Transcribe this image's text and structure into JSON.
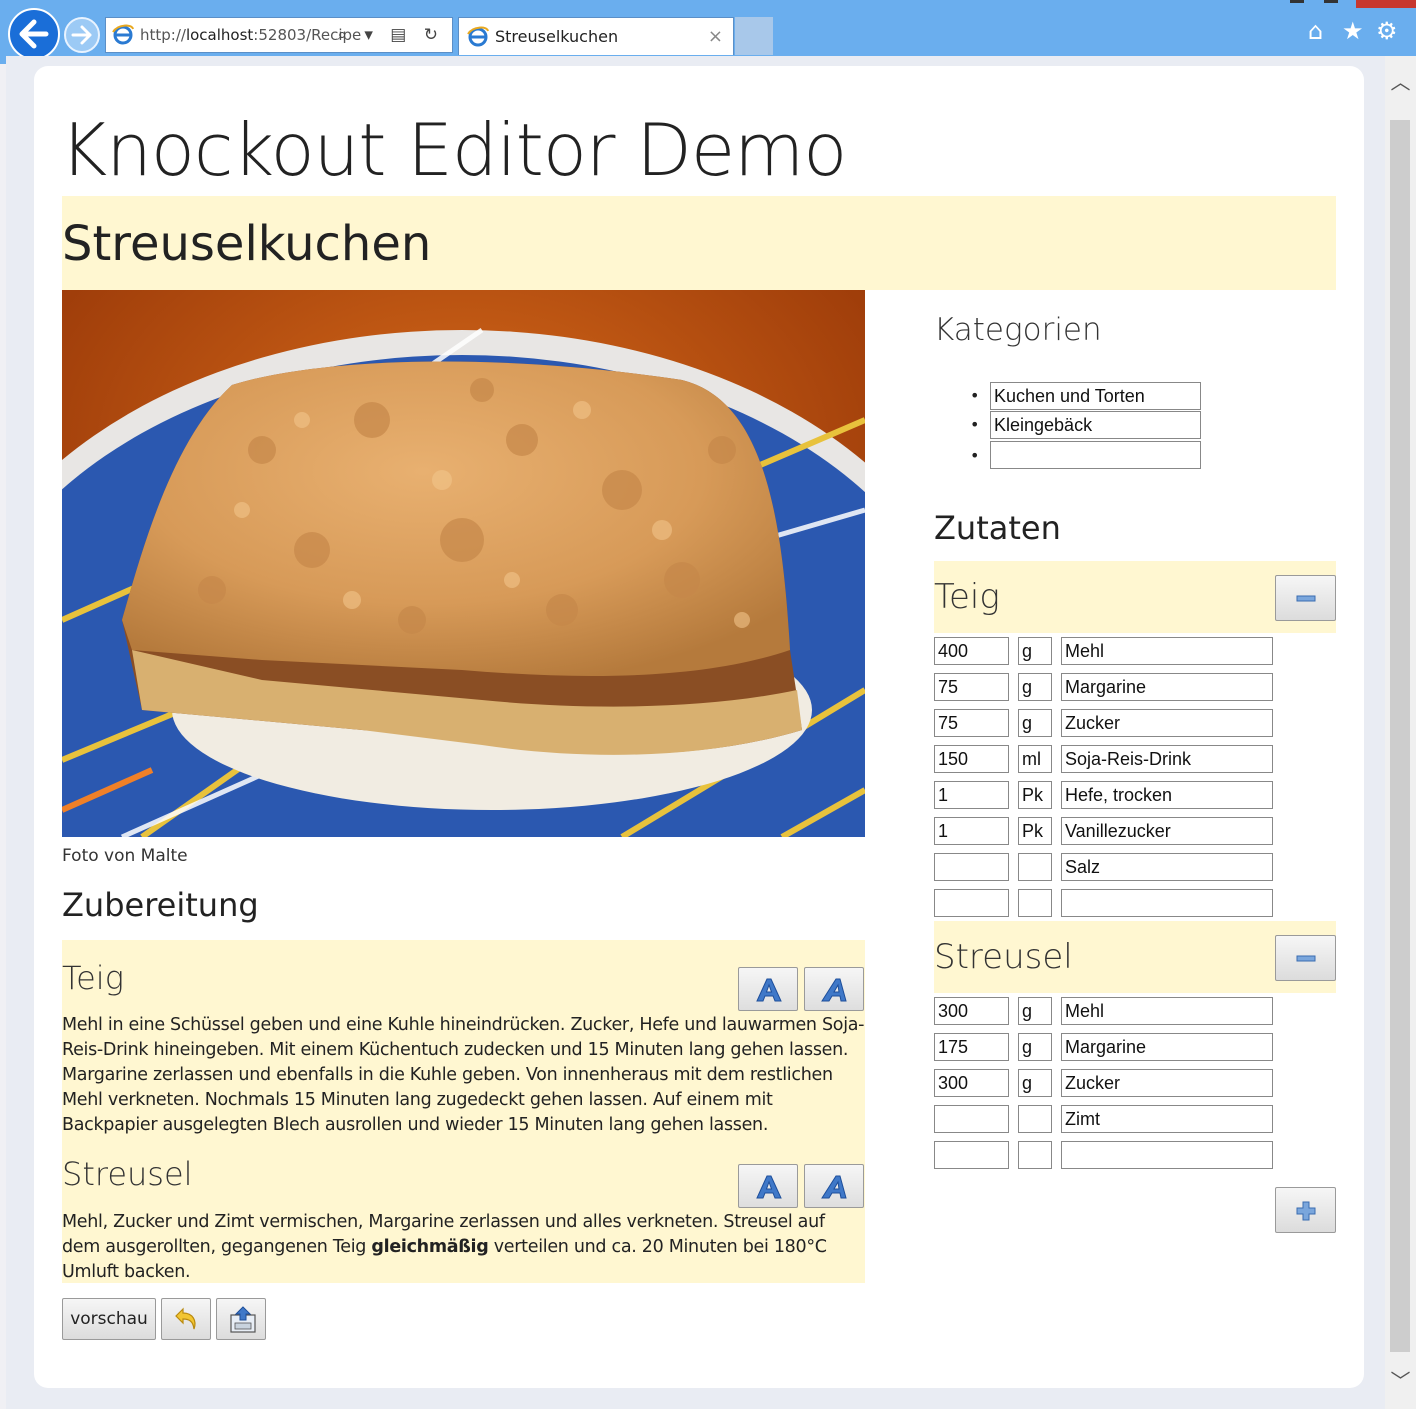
{
  "browser": {
    "url_prefix": "http://",
    "url_host": "localhost",
    "url_rest": ":52803/Recipe",
    "address_tools": "⌕ ▾ ▤ ↻",
    "tab_title": "Streuselkuchen",
    "tab_close": "×"
  },
  "page": {
    "title": "Knockout Editor Demo",
    "recipe_name": "Streuselkuchen",
    "photo_caption": "Foto von Malte",
    "section_preparation": "Zubereitung",
    "section_categories": "Kategorien",
    "section_ingredients": "Zutaten"
  },
  "categories": [
    "Kuchen und Torten",
    "Kleingebäck",
    ""
  ],
  "steps": [
    {
      "title": "Teig",
      "text": "Mehl in eine Schüssel geben und eine Kuhle hineindrücken. Zucker, Hefe und lauwarmen Soja-Reis-Drink hineingeben. Mit einem Küchentuch zudecken und 15 Minuten lang gehen lassen. Margarine zerlassen und ebenfalls in die Kuhle geben. Von innenheraus mit dem restlichen Mehl verkneten. Nochmals 15 Minuten lang zugedeckt gehen lassen. Auf einem mit Backpapier ausgelegten Blech ausrollen und wieder 15 Minuten lang gehen lassen."
    },
    {
      "title": "Streusel",
      "text_before": "Mehl, Zucker und Zimt vermischen, Margarine zerlassen und alles verkneten. Streusel auf dem ausgerollten, gegangenen Teig ",
      "text_bold": "gleichmäßig",
      "text_after": " verteilen und ca. 20 Minuten bei 180°C Umluft backen."
    }
  ],
  "ingredient_groups": [
    {
      "name": "Teig",
      "items": [
        {
          "amount": "400",
          "unit": "g",
          "name": "Mehl"
        },
        {
          "amount": "75",
          "unit": "g",
          "name": "Margarine"
        },
        {
          "amount": "75",
          "unit": "g",
          "name": "Zucker"
        },
        {
          "amount": "150",
          "unit": "ml",
          "name": "Soja-Reis-Drink"
        },
        {
          "amount": "1",
          "unit": "Pk",
          "name": "Hefe, trocken"
        },
        {
          "amount": "1",
          "unit": "Pk",
          "name": "Vanillezucker"
        },
        {
          "amount": "",
          "unit": "",
          "name": "Salz"
        },
        {
          "amount": "",
          "unit": "",
          "name": ""
        }
      ]
    },
    {
      "name": "Streusel",
      "items": [
        {
          "amount": "300",
          "unit": "g",
          "name": "Mehl"
        },
        {
          "amount": "175",
          "unit": "g",
          "name": "Margarine"
        },
        {
          "amount": "300",
          "unit": "g",
          "name": "Zucker"
        },
        {
          "amount": "",
          "unit": "",
          "name": "Zimt"
        },
        {
          "amount": "",
          "unit": "",
          "name": ""
        }
      ]
    }
  ],
  "actions": {
    "preview_label": "vorschau"
  },
  "icons": {
    "back": "back-arrow-icon",
    "forward": "forward-arrow-icon",
    "home": "home-icon",
    "favorites": "star-icon",
    "settings": "gear-icon",
    "bold": "bold-a-icon",
    "italic": "italic-a-icon",
    "undo": "undo-icon",
    "save": "save-icon",
    "remove": "minus-icon",
    "add": "plus-icon"
  },
  "colors": {
    "chrome": "#6aaeee",
    "highlight": "#fff7d1",
    "accent_icon": "#3f78c8"
  }
}
